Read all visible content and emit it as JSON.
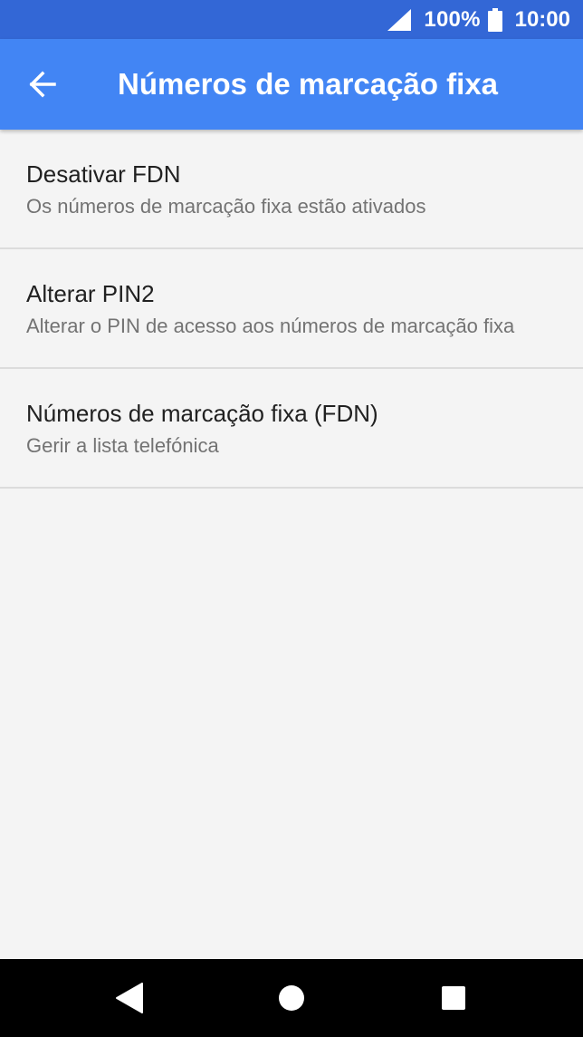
{
  "status_bar": {
    "battery_percent": "100%",
    "time": "10:00",
    "icons": [
      "signal-icon",
      "battery-icon"
    ]
  },
  "app_bar": {
    "title": "Números de marcação fixa",
    "back_icon": "arrow-back-icon"
  },
  "settings": {
    "items": [
      {
        "title": "Desativar FDN",
        "summary": "Os números de marcação fixa estão ativados"
      },
      {
        "title": "Alterar PIN2",
        "summary": "Alterar o PIN de acesso aos números de marcação fixa"
      },
      {
        "title": "Números de marcação fixa (FDN)",
        "summary": "Gerir a lista telefónica"
      }
    ]
  },
  "nav_bar": {
    "icons": [
      "nav-back-icon",
      "nav-home-icon",
      "nav-recents-icon"
    ]
  },
  "colors": {
    "status_bar": "#3367d6",
    "app_bar": "#4285f4",
    "background": "#f4f4f4",
    "title_text": "#212121",
    "summary_text": "#737373",
    "divider": "#dcdcdc"
  }
}
